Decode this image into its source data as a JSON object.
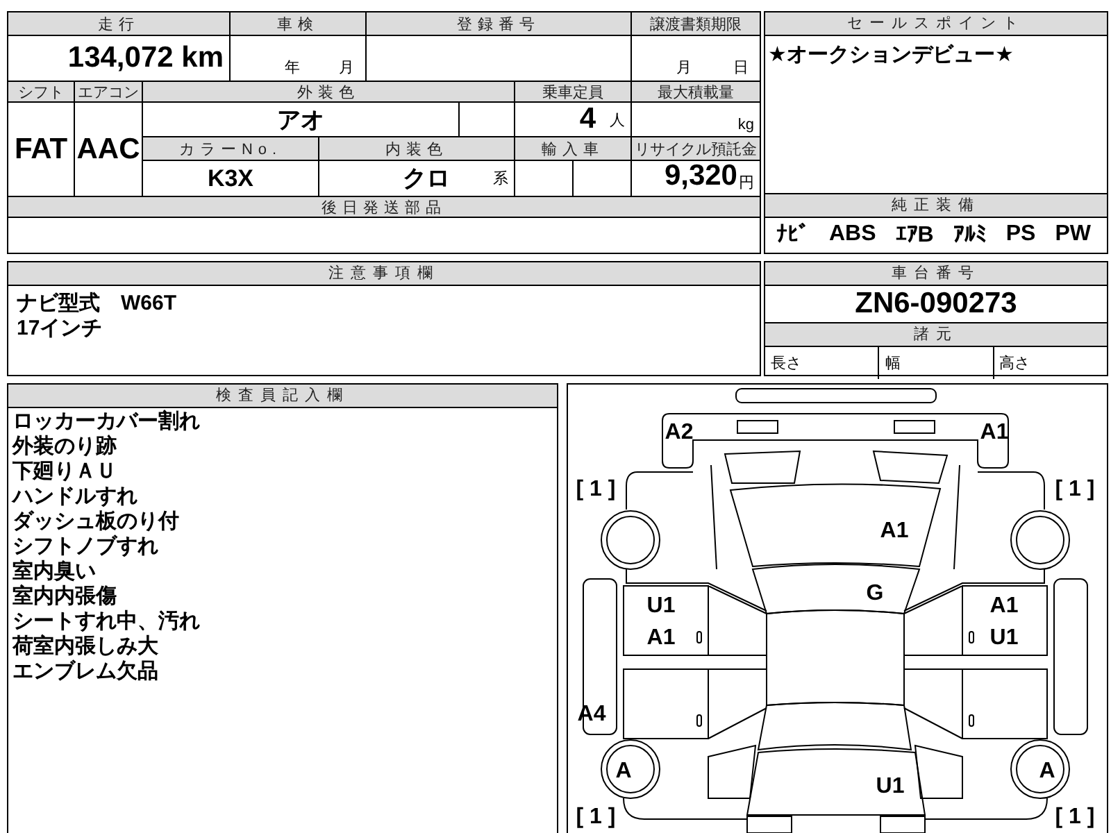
{
  "mileage": {
    "label": "走行",
    "value": "134,072 km"
  },
  "shaken": {
    "label": "車検",
    "year_unit": "年",
    "month_unit": "月"
  },
  "registration_number": {
    "label": "登録番号"
  },
  "transfer_deadline": {
    "label": "譲渡書類期限",
    "month_unit": "月",
    "day_unit": "日"
  },
  "shift": {
    "label": "シフト",
    "value": "FAT"
  },
  "aircon": {
    "label": "エアコン",
    "value": "AAC"
  },
  "exterior_color": {
    "label": "外装色",
    "value": "アオ"
  },
  "capacity": {
    "label": "乗車定員",
    "value": "4",
    "unit": "人"
  },
  "max_load": {
    "label": "最大積載量",
    "unit": "kg"
  },
  "color_no": {
    "label": "カラーNo.",
    "value": "K3X"
  },
  "interior_color": {
    "label": "内装色",
    "value": "クロ",
    "suffix": "系"
  },
  "import": {
    "label": "輸入車"
  },
  "recycle_fee": {
    "label": "リサイクル預託金",
    "value": "9,320",
    "unit": "円"
  },
  "later_parts": {
    "label": "後日発送部品"
  },
  "sales_point": {
    "label": "セールスポイント",
    "text": "★オークションデビュー★"
  },
  "equipment": {
    "label": "純正装備",
    "items": [
      "ﾅﾋﾞ",
      "ABS",
      "ｴｱB",
      "ｱﾙﾐ",
      "PS",
      "PW"
    ]
  },
  "notes": {
    "label": "注意事項欄",
    "lines": [
      "ナビ型式　W66T",
      "17インチ"
    ]
  },
  "chassis": {
    "label": "車台番号",
    "value": "ZN6-090273"
  },
  "specs": {
    "label": "諸元",
    "items": [
      "長さ",
      "幅",
      "高さ"
    ]
  },
  "inspector": {
    "label": "検査員記入欄",
    "lines": [
      "ロッカーカバー割れ",
      "外装のり跡",
      "下廻りＡＵ",
      "ハンドルすれ",
      "ダッシュ板のり付",
      "シフトノブすれ",
      "室内臭い",
      "室内内張傷",
      "シートすれ中、汚れ",
      "荷室内張しみ大",
      "エンブレム欠品"
    ]
  },
  "damage_marks": {
    "front_bumper_left": [
      "A2"
    ],
    "front_bumper_right": [
      "A1"
    ],
    "front_left_corner": [
      "[ 1 ]"
    ],
    "front_right_corner": [
      "[ 1 ]"
    ],
    "hood": [
      "A1"
    ],
    "windshield": [
      "G"
    ],
    "left_front_door": [
      "U1",
      "A1"
    ],
    "right_front_door": [
      "A1",
      "U1"
    ],
    "left_rocker": [
      "A4"
    ],
    "left_rear_tire": [
      "A"
    ],
    "right_rear_tire": [
      "A"
    ],
    "rear": [
      "U1"
    ],
    "rear_left_corner": [
      "[ 1 ]"
    ],
    "rear_right_corner": [
      "[ 1 ]"
    ]
  }
}
